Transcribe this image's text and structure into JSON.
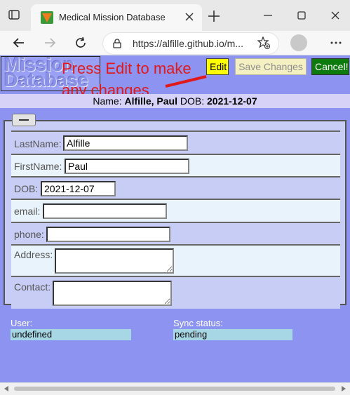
{
  "browser": {
    "tab_title": "Medical Mission Database",
    "url": "https://alfille.github.io/m...",
    "icons": [
      "tab-actions-icon",
      "favicon-icon",
      "close-tab-icon",
      "new-tab-icon",
      "minimize-icon",
      "maximize-icon",
      "close-window-icon",
      "back-icon",
      "forward-icon",
      "refresh-icon",
      "lock-icon",
      "add-favorite-icon",
      "profile-icon",
      "more-icon"
    ]
  },
  "header": {
    "logo_text": "Mission\nDatabase",
    "annotation": "Press Edit to make any changes",
    "annotation_color": "#e01a1a",
    "edit_label": "Edit",
    "save_label": "Save Changes",
    "cancel_label": "Cancel!"
  },
  "namebar": {
    "prefix": "Name:",
    "last": "Alfille",
    "comma": ",",
    "first": "Paul",
    "dob_label": "DOB:",
    "dob": "2021-12-07"
  },
  "form": {
    "fields": [
      {
        "label": "LastName:",
        "value": "Alfille"
      },
      {
        "label": "FirstName:",
        "value": "Paul"
      },
      {
        "label": "DOB:",
        "value": "2021-12-07"
      },
      {
        "label": "email:",
        "value": ""
      },
      {
        "label": "phone:",
        "value": ""
      },
      {
        "label": "Address:",
        "value": ""
      },
      {
        "label": "Contact:",
        "value": ""
      }
    ]
  },
  "status": {
    "user_label": "User:",
    "user_value": "undefined",
    "sync_label": "Sync status:",
    "sync_value": "pending"
  },
  "colors": {
    "page_bg": "#8c93f0",
    "edit_button": "#ffff00",
    "cancel_button": "#0d7a0d",
    "save_button": "#f4f0c2"
  }
}
